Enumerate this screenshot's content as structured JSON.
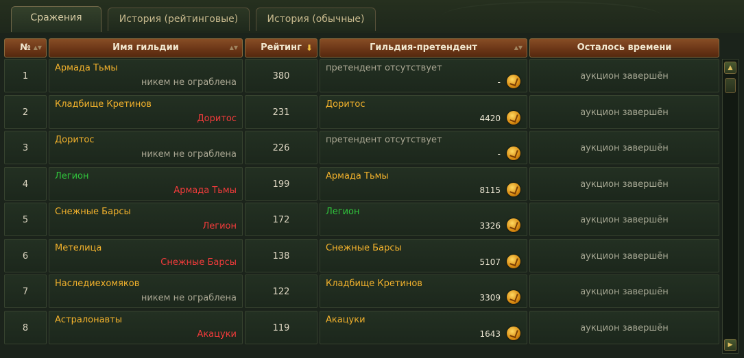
{
  "tabs": [
    {
      "label": "Сражения",
      "active": true
    },
    {
      "label": "История (рейтинговые)",
      "active": false
    },
    {
      "label": "История (обычные)",
      "active": false
    }
  ],
  "columns": {
    "num": "№",
    "guild": "Имя гильдии",
    "rating": "Рейтинг",
    "challenger": "Гильдия-претендент",
    "time": "Осталось времени"
  },
  "sort": {
    "column": "rating",
    "direction": "desc"
  },
  "colors": {
    "guild_name": "#f3b22c",
    "guild_green": "#30c43c",
    "robber": "#f23b3b",
    "muted": "#a9a692"
  },
  "rows": [
    {
      "num": "1",
      "guild": "Армада Тьмы",
      "guild_color": "gold",
      "robbed_by": "никем не ограблена",
      "robbed_color": "none",
      "rating": "380",
      "challenger": "претендент отсутствует",
      "challenger_color": "none",
      "bid": "-",
      "time": "аукцион завершён"
    },
    {
      "num": "2",
      "guild": "Кладбище Кретинов",
      "guild_color": "gold",
      "robbed_by": "Доритос",
      "robbed_color": "red",
      "rating": "231",
      "challenger": "Доритос",
      "challenger_color": "gold",
      "bid": "4420",
      "time": "аукцион завершён"
    },
    {
      "num": "3",
      "guild": "Доритос",
      "guild_color": "gold",
      "robbed_by": "никем не ограблена",
      "robbed_color": "none",
      "rating": "226",
      "challenger": "претендент отсутствует",
      "challenger_color": "none",
      "bid": "-",
      "time": "аукцион завершён"
    },
    {
      "num": "4",
      "guild": "Легион",
      "guild_color": "green",
      "robbed_by": "Армада Тьмы",
      "robbed_color": "red",
      "rating": "199",
      "challenger": "Армада Тьмы",
      "challenger_color": "gold",
      "bid": "8115",
      "time": "аукцион завершён"
    },
    {
      "num": "5",
      "guild": "Снежные Барсы",
      "guild_color": "gold",
      "robbed_by": "Легион",
      "robbed_color": "red",
      "rating": "172",
      "challenger": "Легион",
      "challenger_color": "green",
      "bid": "3326",
      "time": "аукцион завершён"
    },
    {
      "num": "6",
      "guild": "Метелица",
      "guild_color": "gold",
      "robbed_by": "Снежные Барсы",
      "robbed_color": "red",
      "rating": "138",
      "challenger": "Снежные Барсы",
      "challenger_color": "gold",
      "bid": "5107",
      "time": "аукцион завершён"
    },
    {
      "num": "7",
      "guild": "Наследиехомяков",
      "guild_color": "gold",
      "robbed_by": "никем не ограблена",
      "robbed_color": "none",
      "rating": "122",
      "challenger": "Кладбище Кретинов",
      "challenger_color": "gold",
      "bid": "3309",
      "time": "аукцион завершён"
    },
    {
      "num": "8",
      "guild": "Астралонавты",
      "guild_color": "gold",
      "robbed_by": "Акацуки",
      "robbed_color": "red",
      "rating": "119",
      "challenger": "Акацуки",
      "challenger_color": "gold",
      "bid": "1643",
      "time": "аукцион завершён"
    }
  ],
  "icons": {
    "bid_coin": "gold-coin-icon",
    "sort_indicator": "sort-arrow-icon",
    "scroll_up": "scroll-up-icon",
    "scroll_down": "scroll-down-icon"
  }
}
